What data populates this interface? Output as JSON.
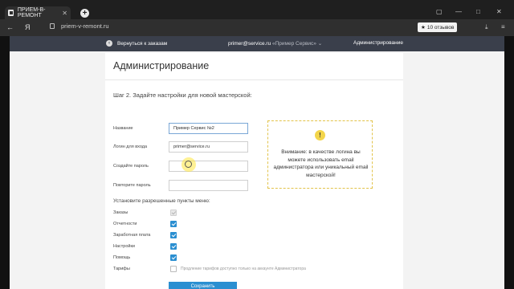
{
  "browser": {
    "tab_title": "ПРИЕМ-В-РЕМОНТ",
    "tab_close": "✕",
    "new_tab": "+",
    "nav_back": "←",
    "yandex": "Я",
    "url": "priem-v-remont.ru",
    "reviews_star": "★",
    "reviews": "10 отзывов",
    "win_minimize": "—",
    "win_maximize": "□",
    "win_close": "✕"
  },
  "topnav": {
    "back_label": "Вернуться к заказам",
    "user_email": "primer@service.ru",
    "service_name": "«Пример Сервис»",
    "chevron": "⌄",
    "admin_label": "Администрирование"
  },
  "page": {
    "title": "Администрирование",
    "step_text": "Шаг 2. Задайте настройки для новой мастерской:"
  },
  "form": {
    "name_label": "Название",
    "name_value": "Пример Сервис №2",
    "login_label": "Логин для входа",
    "login_value": "primer@service.ru",
    "password_label": "Создайте пароль",
    "password_value": "",
    "repeat_label": "Повторите пароль",
    "repeat_value": ""
  },
  "hint": {
    "icon": "!",
    "text": "Внимание: в качестве логина вы можете использовать email администратора или уникальный email мастерской!"
  },
  "menu": {
    "title": "Установите разрешенные пункты меню:",
    "items": [
      {
        "label": "Заказы",
        "checked": true,
        "disabled": true
      },
      {
        "label": "Отчетности",
        "checked": true,
        "disabled": false
      },
      {
        "label": "Заработная плата",
        "checked": true,
        "disabled": false
      },
      {
        "label": "Настройки",
        "checked": true,
        "disabled": false
      },
      {
        "label": "Помощь",
        "checked": true,
        "disabled": false
      },
      {
        "label": "Тарифы",
        "checked": false,
        "disabled": true
      }
    ],
    "tariff_note": "Продление тарифов доступно только на аккаунте Администратора"
  },
  "save_label": "Сохранить",
  "colors": {
    "accent": "#2b8fd1",
    "nav_bg": "#3a3f4b",
    "warning": "#f3d54a"
  }
}
